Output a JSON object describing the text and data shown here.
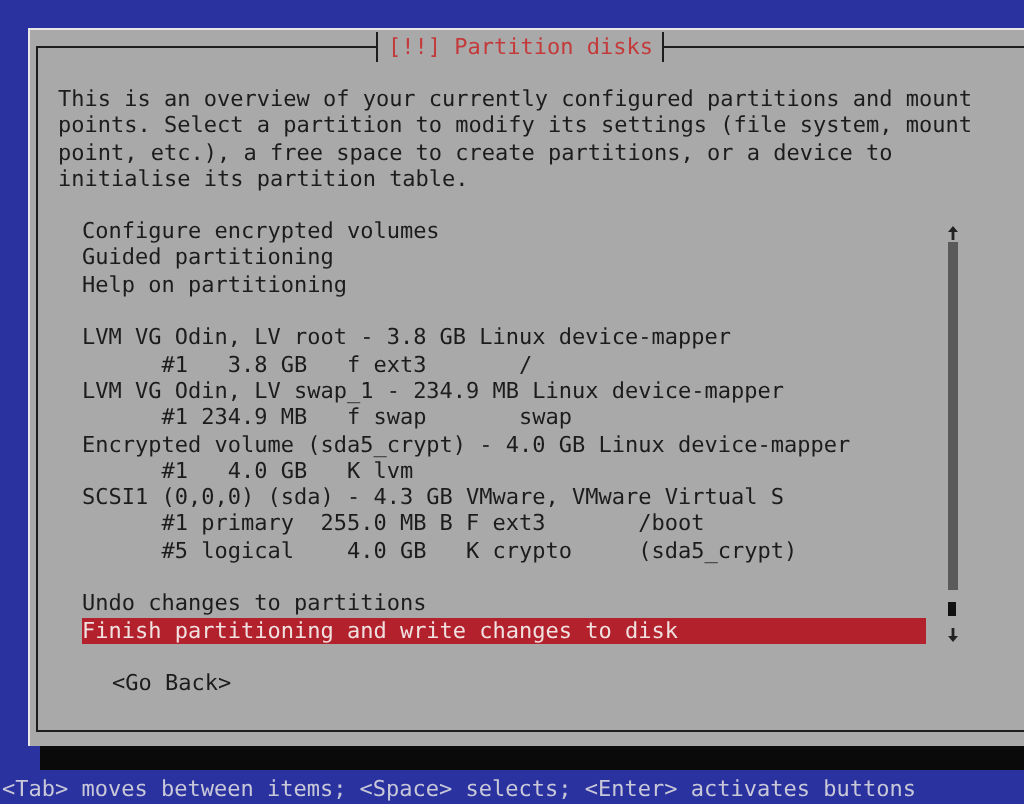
{
  "dialog": {
    "title": "[!!] Partition disks",
    "description": "This is an overview of your currently configured partitions and mount points. Select a partition to modify its settings (file system, mount point, etc.), a free space to create partitions, or a device to initialise its partition table.",
    "menu": [
      {
        "items": [
          {
            "label": "Configure encrypted volumes",
            "selected": false
          },
          {
            "label": "Guided partitioning",
            "selected": false
          },
          {
            "label": "Help on partitioning",
            "selected": false
          }
        ]
      },
      {
        "items": [
          {
            "label": "LVM VG Odin, LV root - 3.8 GB Linux device-mapper",
            "selected": false,
            "children": [
              {
                "label": "#1   3.8 GB   f ext3       /",
                "selected": false
              }
            ]
          },
          {
            "label": "LVM VG Odin, LV swap_1 - 234.9 MB Linux device-mapper",
            "selected": false,
            "children": [
              {
                "label": "#1 234.9 MB   f swap       swap",
                "selected": false
              }
            ]
          },
          {
            "label": "Encrypted volume (sda5_crypt) - 4.0 GB Linux device-mapper",
            "selected": false,
            "children": [
              {
                "label": "#1   4.0 GB   K lvm",
                "selected": false
              }
            ]
          },
          {
            "label": "SCSI1 (0,0,0) (sda) - 4.3 GB VMware, VMware Virtual S",
            "selected": false,
            "children": [
              {
                "label": "#1 primary  255.0 MB B F ext3       /boot",
                "selected": false
              },
              {
                "label": "#5 logical    4.0 GB   K crypto     (sda5_crypt)",
                "selected": false
              }
            ]
          }
        ]
      },
      {
        "items": [
          {
            "label": "Undo changes to partitions",
            "selected": false
          },
          {
            "label": "Finish partitioning and write changes to disk",
            "selected": true
          }
        ]
      }
    ],
    "buttons": [
      {
        "label": "<Go Back>"
      }
    ]
  },
  "status_bar": "<Tab> moves between items; <Space> selects; <Enter> activates buttons"
}
